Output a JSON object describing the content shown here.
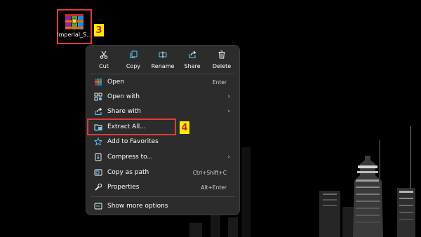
{
  "desktop": {
    "file_label": "Imperial_S...",
    "step_icon": "3",
    "step_extract": "4"
  },
  "toolbar": {
    "cut": "Cut",
    "copy": "Copy",
    "rename": "Rename",
    "share": "Share",
    "delete": "Delete"
  },
  "menu": {
    "items": [
      {
        "label": "Open",
        "shortcut": "Enter",
        "icon": "winrar-icon"
      },
      {
        "label": "Open with",
        "icon": "open-with-icon",
        "submenu": true
      },
      {
        "label": "Share with",
        "icon": "share-with-icon",
        "submenu": true
      },
      {
        "label": "Extract All...",
        "icon": "extract-icon"
      },
      {
        "label": "Add to Favorites",
        "icon": "star-icon"
      },
      {
        "label": "Compress to...",
        "icon": "compress-icon",
        "submenu": true
      },
      {
        "label": "Copy as path",
        "shortcut": "Ctrl+Shift+C",
        "icon": "copy-path-icon"
      },
      {
        "label": "Properties",
        "shortcut": "Alt+Enter",
        "icon": "wrench-icon"
      },
      {
        "label": "Show more options",
        "icon": "more-options-icon"
      }
    ]
  },
  "colors": {
    "menu_bg": "#2c2c2c",
    "highlight": "#e53935",
    "step_badge": "#ffea00",
    "accent": "#60cdff"
  }
}
